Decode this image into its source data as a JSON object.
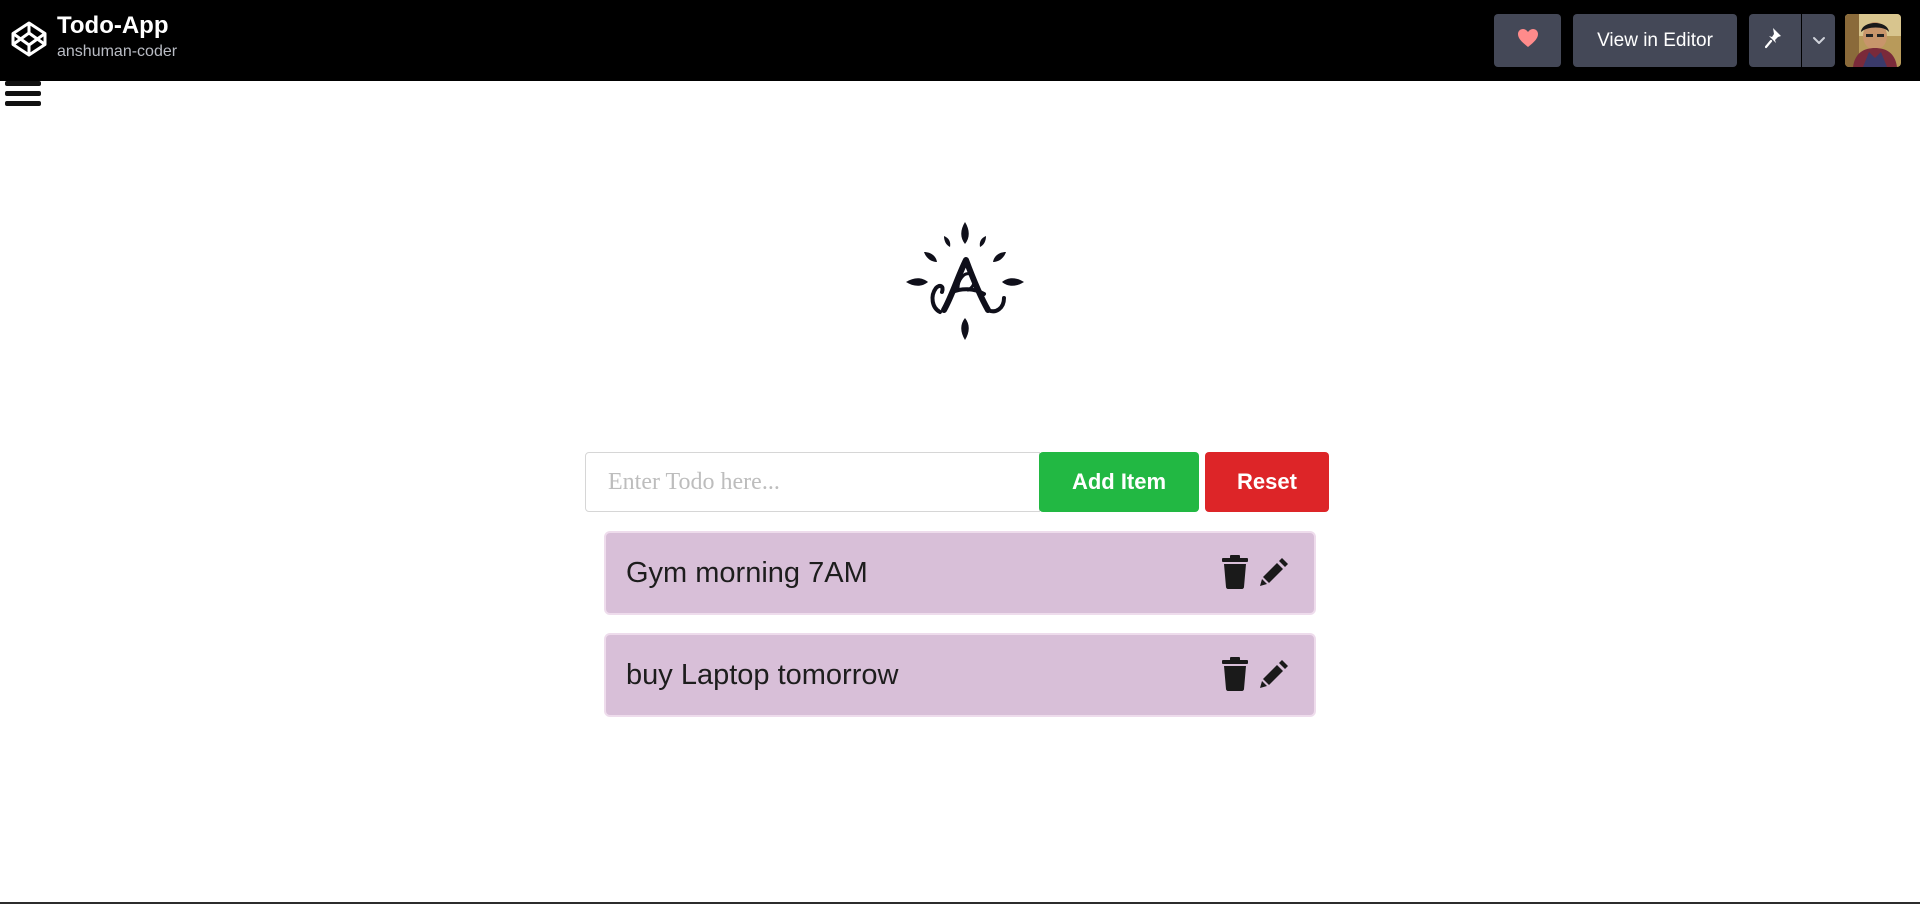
{
  "header": {
    "title": "Todo-App",
    "username": "anshuman-coder",
    "view_in_editor_label": "View in Editor",
    "icons": {
      "brand": "codepen-cube-icon",
      "heart": "heart-icon",
      "pin": "pin-icon",
      "caret": "chevron-down-icon"
    },
    "colors": {
      "bar": "#000000",
      "button": "#444857",
      "heart": "#ff8b8b"
    }
  },
  "menu": {
    "icon": "hamburger-menu-icon"
  },
  "logo": {
    "icon": "decorative-a-monogram-logo"
  },
  "form": {
    "input_placeholder": "Enter Todo here...",
    "input_value": "",
    "add_label": "Add Item",
    "reset_label": "Reset",
    "colors": {
      "add": "#22b843",
      "reset": "#dd2528"
    }
  },
  "todos": [
    {
      "text": "Gym morning 7AM"
    },
    {
      "text": "buy Laptop tomorrow"
    }
  ],
  "todo_icons": {
    "delete": "trash-icon",
    "edit": "pencil-icon"
  },
  "todo_color": "#d8bfd8"
}
